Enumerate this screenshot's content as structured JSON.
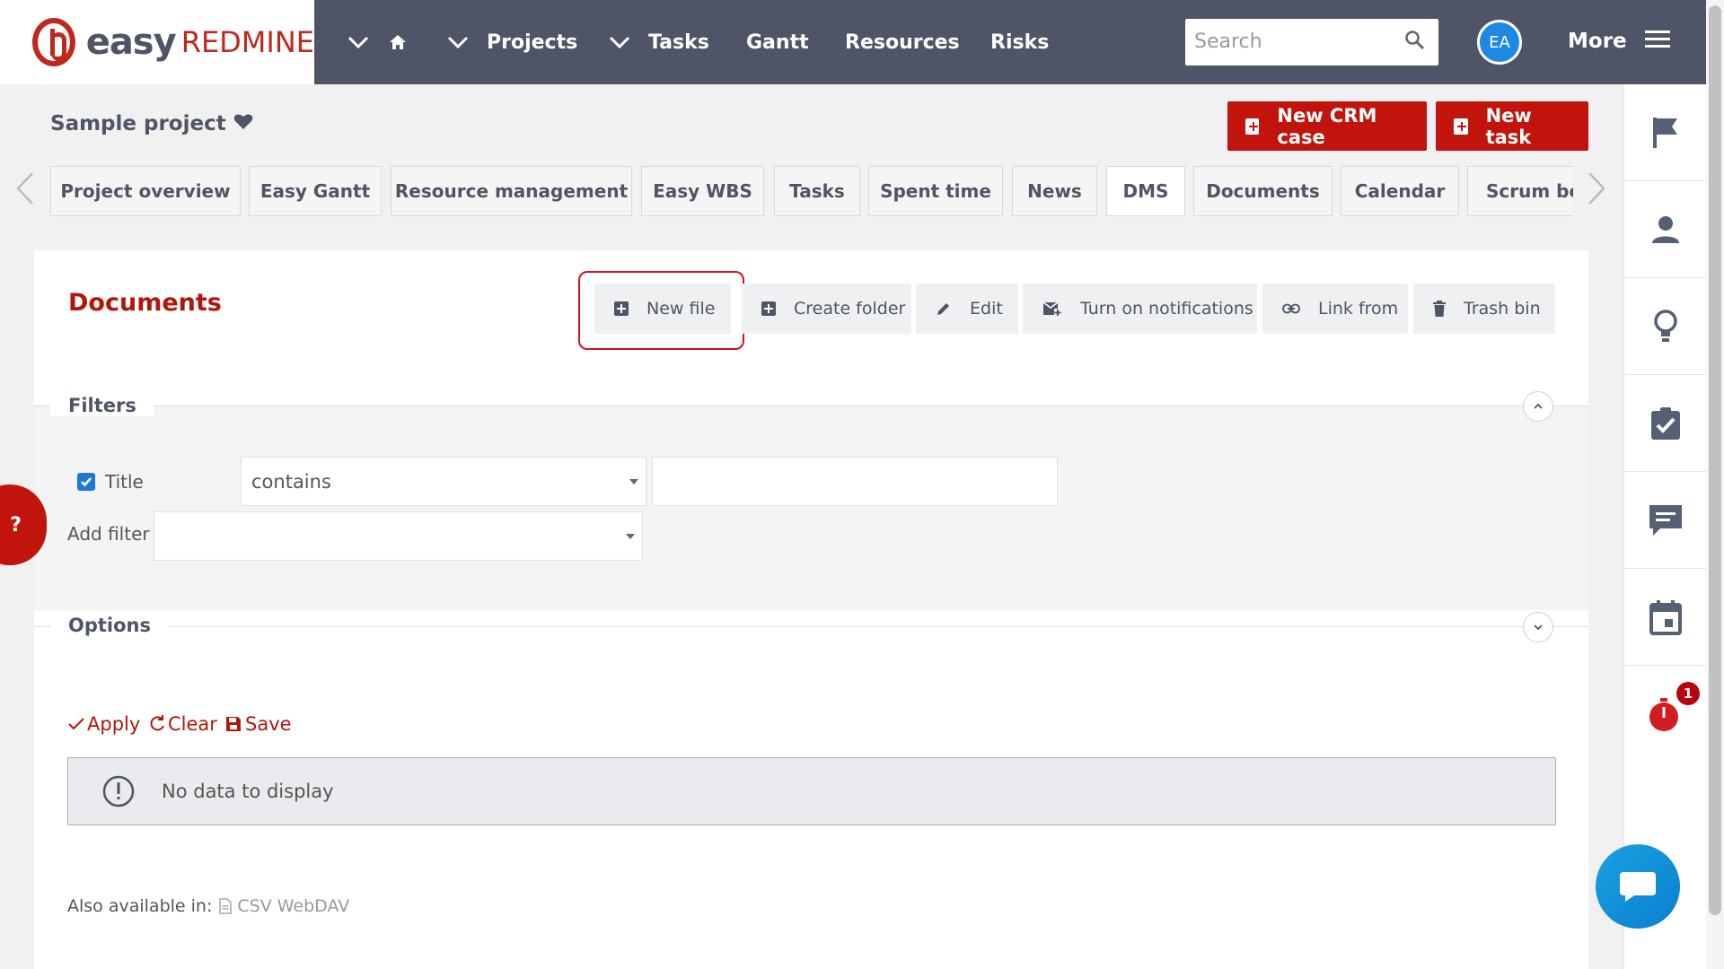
{
  "header": {
    "logo_easy": "easy",
    "logo_redmine": "REDMINE",
    "nav": [
      "Projects",
      "Tasks",
      "Gantt",
      "Resources",
      "Risks"
    ],
    "search_placeholder": "Search",
    "avatar_initials": "EA",
    "more_label": "More"
  },
  "project": {
    "title": "Sample project",
    "new_crm_case": "New CRM case",
    "new_task": "New task"
  },
  "tabs": [
    "Project overview",
    "Easy Gantt",
    "Resource management",
    "Easy WBS",
    "Tasks",
    "Spent time",
    "News",
    "DMS",
    "Documents",
    "Calendar",
    "Scrum boa"
  ],
  "active_tab": "DMS",
  "documents": {
    "title": "Documents",
    "toolbar": {
      "new_file": "New file",
      "create_folder": "Create folder",
      "edit": "Edit",
      "notifications": "Turn on notifications",
      "link_from": "Link from",
      "trash_bin": "Trash bin"
    }
  },
  "filters": {
    "title": "Filters",
    "title_filter_label": "Title",
    "operator": "contains",
    "value": "",
    "add_filter_label": "Add filter",
    "add_filter_value": ""
  },
  "options": {
    "title": "Options"
  },
  "actions": {
    "apply": "Apply",
    "clear": "Clear",
    "save": "Save"
  },
  "nodata": "No data to display",
  "also": {
    "label": "Also available in:",
    "formats": "CSV WebDAV"
  },
  "help_label": "?",
  "notification_count": "1",
  "icons": [
    "chevron-down-icon",
    "home-icon",
    "search-icon",
    "hamburger-icon",
    "flag-icon",
    "user-icon",
    "lightbulb-icon",
    "checklist-icon",
    "comment-icon",
    "calendar-icon",
    "timer-icon",
    "chat-icon",
    "plus-icon",
    "pencil-icon",
    "mail-icon",
    "link-icon",
    "trash-icon",
    "alert-icon",
    "file-icon"
  ],
  "colors": {
    "topbar": "#4f5566",
    "brand_red": "#c0140c",
    "title_red": "#b1160d",
    "avatar_blue": "#1e88e5"
  }
}
